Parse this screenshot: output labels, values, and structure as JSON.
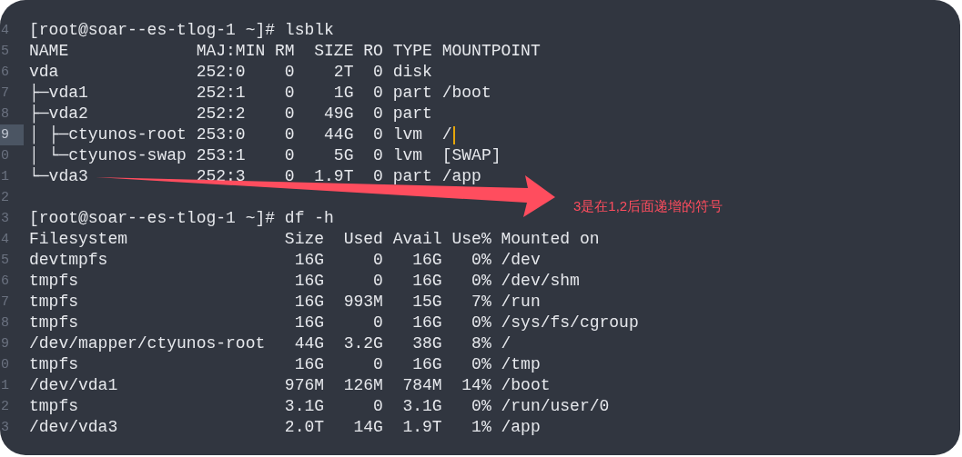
{
  "lines": [
    {
      "number": "4",
      "text": "[root@soar--es-tlog-1 ~]# lsblk",
      "current": false
    },
    {
      "number": "5",
      "text": "NAME             MAJ:MIN RM  SIZE RO TYPE MOUNTPOINT",
      "current": false
    },
    {
      "number": "6",
      "text": "vda              252:0    0    2T  0 disk",
      "current": false
    },
    {
      "number": "7",
      "text": "├─vda1           252:1    0    1G  0 part /boot",
      "current": false
    },
    {
      "number": "8",
      "text": "├─vda2           252:2    0   49G  0 part",
      "current": false
    },
    {
      "number": "9",
      "text": "│ ├─ctyunos-root 253:0    0   44G  0 lvm  /",
      "current": true
    },
    {
      "number": "0",
      "text": "│ └─ctyunos-swap 253:1    0    5G  0 lvm  [SWAP]",
      "current": false
    },
    {
      "number": "1",
      "text": "└─vda3           252:3    0  1.9T  0 part /app",
      "current": false
    },
    {
      "number": "2",
      "current": false
    },
    {
      "number": "3",
      "text": "[root@soar--es-tlog-1 ~]# df -h",
      "current": false
    },
    {
      "number": "4",
      "text": "Filesystem                Size  Used Avail Use% Mounted on",
      "current": false
    },
    {
      "number": "5",
      "text": "devtmpfs                   16G     0   16G   0% /dev",
      "current": false
    },
    {
      "number": "6",
      "text": "tmpfs                      16G     0   16G   0% /dev/shm",
      "current": false
    },
    {
      "number": "7",
      "text": "tmpfs                      16G  993M   15G   7% /run",
      "current": false
    },
    {
      "number": "8",
      "text": "tmpfs                      16G     0   16G   0% /sys/fs/cgroup",
      "current": false
    },
    {
      "number": "9",
      "text": "/dev/mapper/ctyunos-root   44G  3.2G   38G   8% /",
      "current": false
    },
    {
      "number": "0",
      "text": "tmpfs                      16G     0   16G   0% /tmp",
      "current": false
    },
    {
      "number": "1",
      "text": "/dev/vda1                 976M  126M  784M  14% /boot",
      "current": false
    },
    {
      "number": "2",
      "text": "tmpfs                     3.1G     0  3.1G   0% /run/user/0",
      "current": false
    },
    {
      "number": "3",
      "text": "/dev/vda3                 2.0T   14G  1.9T   1% /app",
      "current": false
    }
  ],
  "annotation": {
    "text": "3是在1,2后面递增的符号"
  }
}
